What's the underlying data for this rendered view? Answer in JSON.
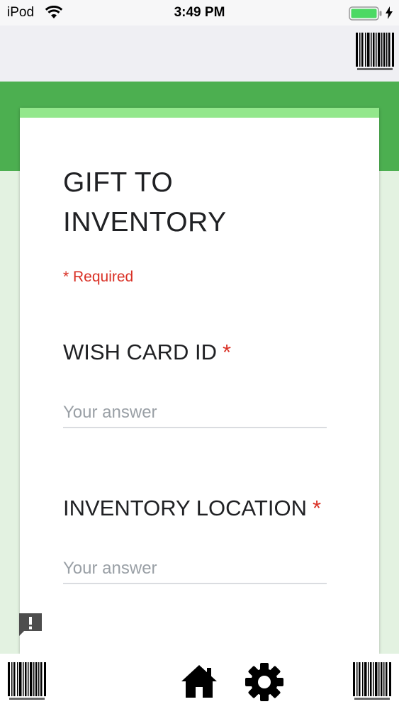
{
  "status_bar": {
    "carrier": "iPod",
    "time": "3:49 PM"
  },
  "form": {
    "title": "GIFT TO INVENTORY",
    "required_note": "* Required",
    "questions": [
      {
        "label": "WISH CARD ID",
        "required_mark": "*",
        "placeholder": "Your answer",
        "value": ""
      },
      {
        "label": "INVENTORY LOCATION",
        "required_mark": "*",
        "placeholder": "Your answer",
        "value": ""
      }
    ]
  },
  "icons": {
    "top_right": "barcode-icon",
    "bottom_left": "barcode-icon",
    "bottom_right": "barcode-icon",
    "bottom_center_1": "home-icon",
    "bottom_center_2": "gear-icon",
    "floating": "feedback-icon"
  },
  "colors": {
    "header_green": "#4caf50",
    "accent_light_green": "#93e78c",
    "background_light_green": "#e3f2e1",
    "required_red": "#d93025"
  }
}
